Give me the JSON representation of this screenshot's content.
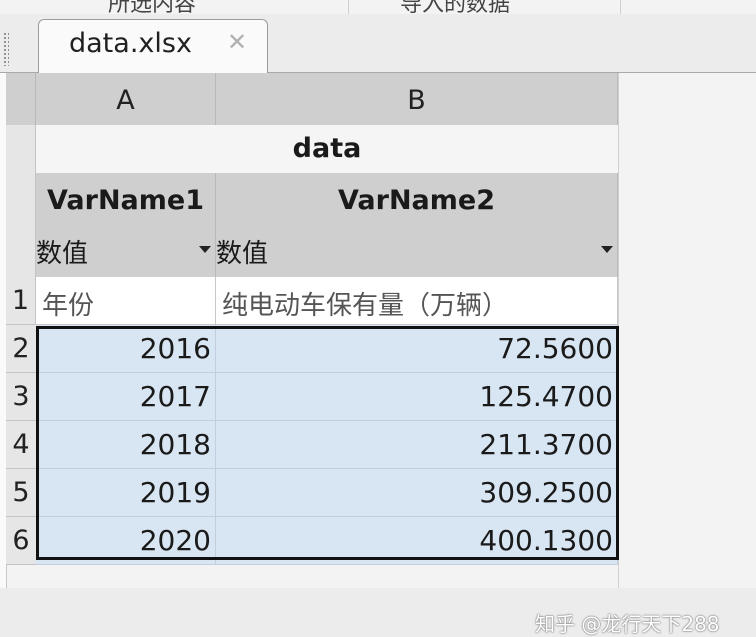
{
  "header": {
    "left_text": "所选内容",
    "right_text": "导入的数据"
  },
  "tab": {
    "label": "data.xlsx",
    "close_glyph": "✕"
  },
  "columns": [
    {
      "letter": "A",
      "var_name": "VarName1",
      "type": "数值"
    },
    {
      "letter": "B",
      "var_name": "VarName2",
      "type": "数值"
    }
  ],
  "table_title": "data",
  "rows": [
    {
      "num": "1",
      "a": "年份",
      "b": "纯电动车保有量（万辆）"
    },
    {
      "num": "2",
      "a": "2016",
      "b": "72.5600"
    },
    {
      "num": "3",
      "a": "2017",
      "b": "125.4700"
    },
    {
      "num": "4",
      "a": "2018",
      "b": "211.3700"
    },
    {
      "num": "5",
      "a": "2019",
      "b": "309.2500"
    },
    {
      "num": "6",
      "a": "2020",
      "b": "400.1300"
    }
  ],
  "watermark": "知乎 @龙行天下288"
}
